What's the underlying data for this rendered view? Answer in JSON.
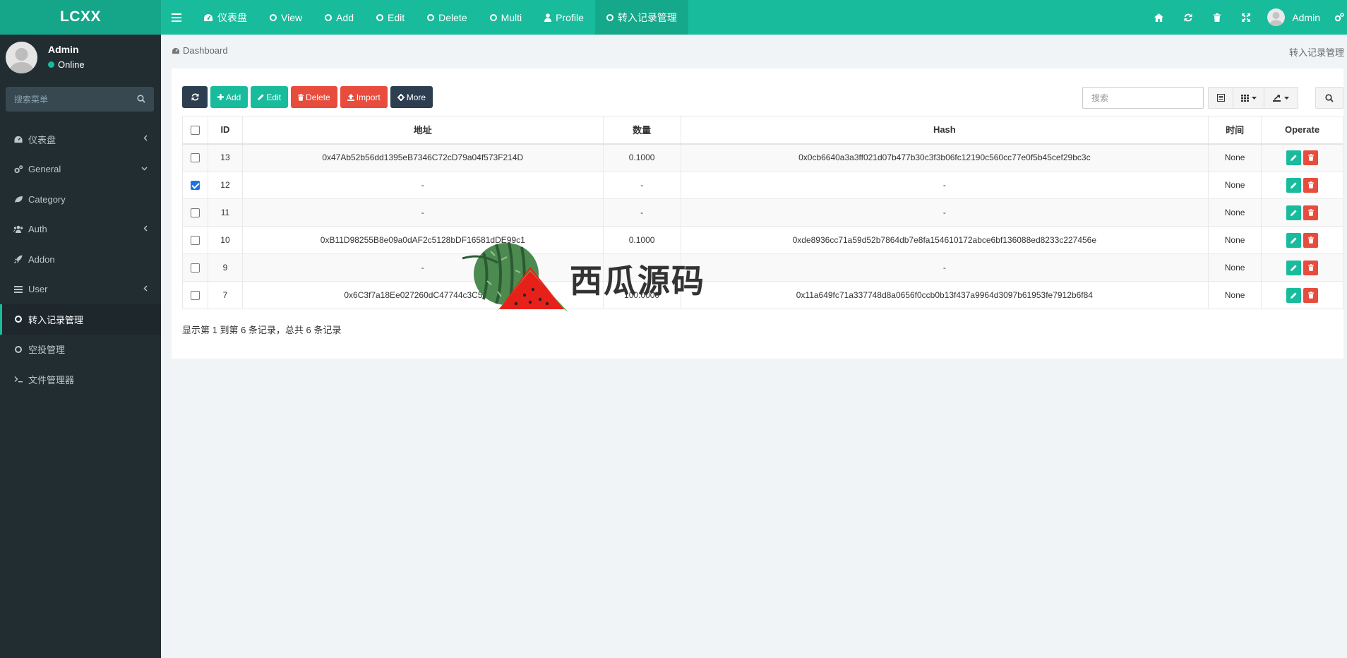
{
  "app": {
    "logo": "LCXX"
  },
  "topnav": {
    "tabs": [
      {
        "label": "仪表盘",
        "icon": "dashboard-icon"
      },
      {
        "label": "View",
        "icon": "circle-icon"
      },
      {
        "label": "Add",
        "icon": "circle-icon"
      },
      {
        "label": "Edit",
        "icon": "circle-icon"
      },
      {
        "label": "Delete",
        "icon": "circle-icon"
      },
      {
        "label": "Multi",
        "icon": "circle-icon"
      },
      {
        "label": "Profile",
        "icon": "user-icon"
      },
      {
        "label": "转入记录管理",
        "icon": "circle-icon",
        "active": true
      }
    ],
    "user": "Admin",
    "accent": "#18bc9c"
  },
  "sidebar": {
    "user": {
      "name": "Admin",
      "status": "Online"
    },
    "search_placeholder": "搜索菜单",
    "items": [
      {
        "label": "仪表盘",
        "icon": "dashboard-icon",
        "has_chevron": "left"
      },
      {
        "label": "General",
        "icon": "cogs-icon",
        "has_chevron": "down"
      },
      {
        "label": "Category",
        "icon": "leaf-icon"
      },
      {
        "label": "Auth",
        "icon": "group-icon",
        "has_chevron": "left"
      },
      {
        "label": "Addon",
        "icon": "rocket-icon"
      },
      {
        "label": "User",
        "icon": "list-icon",
        "has_chevron": "left"
      },
      {
        "label": "转入记录管理",
        "icon": "circle-icon",
        "active": true
      },
      {
        "label": "空投管理",
        "icon": "circle-icon"
      },
      {
        "label": "文件管理器",
        "icon": "terminal-icon"
      }
    ]
  },
  "breadcrumb": {
    "left": "Dashboard",
    "right": "转入记录管理"
  },
  "toolbar": {
    "add": "Add",
    "edit": "Edit",
    "delete": "Delete",
    "import": "Import",
    "more": "More",
    "search_placeholder": "搜索"
  },
  "table": {
    "columns": [
      "ID",
      "地址",
      "数量",
      "Hash",
      "时间",
      "Operate"
    ],
    "rows": [
      {
        "checked": false,
        "id": "13",
        "address": "0x47Ab52b56dd1395eB7346C72cD79a04f573F214D",
        "amount": "0.1000",
        "hash": "0x0cb6640a3a3ff021d07b477b30c3f3b06fc12190c560cc77e0f5b45cef29bc3c",
        "time": "None"
      },
      {
        "checked": true,
        "id": "12",
        "address": "-",
        "amount": "-",
        "hash": "-",
        "time": "None"
      },
      {
        "checked": false,
        "id": "11",
        "address": "-",
        "amount": "-",
        "hash": "-",
        "time": "None"
      },
      {
        "checked": false,
        "id": "10",
        "address": "0xB11D98255B8e09a0dAF2c5128bDF16581dDE99c1",
        "amount": "0.1000",
        "hash": "0xde8936cc71a59d52b7864db7e8fa154610172abce6bf136088ed8233c227456e",
        "time": "None"
      },
      {
        "checked": false,
        "id": "9",
        "address": "-",
        "amount": "-",
        "hash": "-",
        "time": "None"
      },
      {
        "checked": false,
        "id": "7",
        "address": "0x6C3f7a18Ee027260dC47744c3C51a89",
        "amount": "100.0000",
        "hash": "0x11a649fc71a337748d8a0656f0ccb0b13f437a9964d3097b61953fe7912b6f84",
        "time": "None"
      }
    ]
  },
  "pager": {
    "summary": "显示第 1 到第 6 条记录，总共 6 条记录"
  },
  "watermark": {
    "text": "西瓜源码"
  }
}
